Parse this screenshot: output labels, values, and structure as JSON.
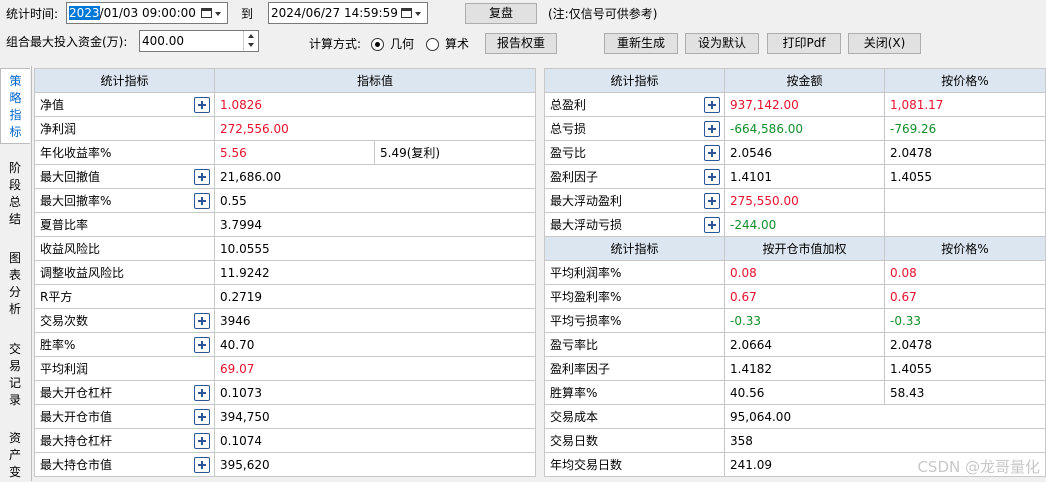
{
  "toolbar": {
    "stat_time_label": "统计时间:",
    "start_date_year": "2023",
    "start_date_rest": "/01/03 09:00:00",
    "to_label": "到",
    "end_date": "2024/06/27 14:59:59",
    "replay_button": "复盘",
    "note": "(注:仅信号可供参考)",
    "max_capital_label": "组合最大投入资金(万):",
    "max_capital_value": "400.00",
    "calc_method_label": "计算方式:",
    "calc_geometric": "几何",
    "calc_arithmetic": "算术",
    "calc_selected": "几何",
    "report_weight_button": "报告权重",
    "regenerate_button": "重新生成",
    "set_default_button": "设为默认",
    "print_pdf_button": "打印Pdf",
    "close_button": "关闭(X)"
  },
  "side_tabs": [
    {
      "label": "策略指标",
      "chars": [
        "策",
        "略",
        "指",
        "标"
      ],
      "active": true
    },
    {
      "label": "阶段总结",
      "chars": [
        "阶",
        "段",
        "总",
        "结"
      ],
      "active": false
    },
    {
      "label": "图表分析",
      "chars": [
        "图",
        "表",
        "分",
        "析"
      ],
      "active": false
    },
    {
      "label": "交易记录",
      "chars": [
        "交",
        "易",
        "记",
        "录"
      ],
      "active": false
    },
    {
      "label": "资产变",
      "chars": [
        "资",
        "产",
        "变"
      ],
      "active": false
    }
  ],
  "left_table": {
    "headers": [
      "统计指标",
      "指标值"
    ],
    "rows": [
      {
        "name": "净值",
        "plus": true,
        "value": "1.0826",
        "color": "red"
      },
      {
        "name": "净利润",
        "plus": false,
        "value": "272,556.00",
        "color": "red"
      },
      {
        "name": "年化收益率%",
        "plus": false,
        "value": "5.56",
        "color": "red",
        "extra": "5.49(复利)"
      },
      {
        "name": "最大回撤值",
        "plus": true,
        "value": "21,686.00",
        "color": ""
      },
      {
        "name": "最大回撤率%",
        "plus": true,
        "value": "0.55",
        "color": ""
      },
      {
        "name": "夏普比率",
        "plus": false,
        "value": "3.7994",
        "color": ""
      },
      {
        "name": "收益风险比",
        "plus": false,
        "value": "10.0555",
        "color": ""
      },
      {
        "name": "调整收益风险比",
        "plus": false,
        "value": "11.9242",
        "color": ""
      },
      {
        "name": "R平方",
        "plus": false,
        "value": "0.2719",
        "color": ""
      },
      {
        "name": "交易次数",
        "plus": true,
        "value": "3946",
        "color": ""
      },
      {
        "name": "胜率%",
        "plus": true,
        "value": "40.70",
        "color": ""
      },
      {
        "name": "平均利润",
        "plus": false,
        "value": "69.07",
        "color": "red"
      },
      {
        "name": "最大开仓杠杆",
        "plus": true,
        "value": "0.1073",
        "color": ""
      },
      {
        "name": "最大开仓市值",
        "plus": true,
        "value": "394,750",
        "color": ""
      },
      {
        "name": "最大持仓杠杆",
        "plus": true,
        "value": "0.1074",
        "color": ""
      },
      {
        "name": "最大持仓市值",
        "plus": true,
        "value": "395,620",
        "color": ""
      }
    ]
  },
  "right_table_top": {
    "headers": [
      "统计指标",
      "按金额",
      "按价格%"
    ],
    "rows": [
      {
        "name": "总盈利",
        "plus": true,
        "v1": "937,142.00",
        "v2": "1,081.17",
        "color": "red"
      },
      {
        "name": "总亏损",
        "plus": true,
        "v1": "-664,586.00",
        "v2": "-769.26",
        "color": "green"
      },
      {
        "name": "盈亏比",
        "plus": true,
        "v1": "2.0546",
        "v2": "2.0478",
        "color": ""
      },
      {
        "name": "盈利因子",
        "plus": true,
        "v1": "1.4101",
        "v2": "1.4055",
        "color": ""
      },
      {
        "name": "最大浮动盈利",
        "plus": true,
        "v1": "275,550.00",
        "v2": "",
        "color": "red"
      },
      {
        "name": "最大浮动亏损",
        "plus": true,
        "v1": "-244.00",
        "v2": "",
        "color": "green"
      }
    ]
  },
  "right_table_bottom": {
    "headers": [
      "统计指标",
      "按开仓市值加权",
      "按价格%"
    ],
    "rows": [
      {
        "name": "平均利润率%",
        "v1": "0.08",
        "v2": "0.08",
        "color": "red"
      },
      {
        "name": "平均盈利率%",
        "v1": "0.67",
        "v2": "0.67",
        "color": "red"
      },
      {
        "name": "平均亏损率%",
        "v1": "-0.33",
        "v2": "-0.33",
        "color": "green"
      },
      {
        "name": "盈亏率比",
        "v1": "2.0664",
        "v2": "2.0478",
        "color": ""
      },
      {
        "name": "盈利率因子",
        "v1": "1.4182",
        "v2": "1.4055",
        "color": ""
      },
      {
        "name": "胜算率%",
        "v1": "40.56",
        "v2": "58.43",
        "color": ""
      },
      {
        "name": "交易成本",
        "v1": "95,064.00",
        "v2": null,
        "color": ""
      },
      {
        "name": "交易日数",
        "v1": "358",
        "v2": null,
        "color": ""
      },
      {
        "name": "年均交易日数",
        "v1": "241.09",
        "v2": null,
        "color": ""
      }
    ]
  },
  "watermark": "CSDN @龙哥量化"
}
